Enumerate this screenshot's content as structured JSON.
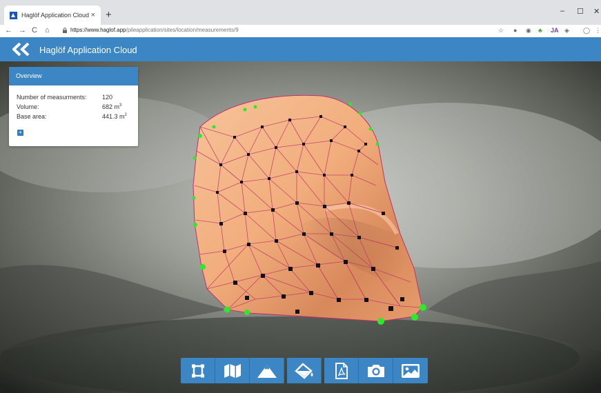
{
  "browser": {
    "tab_title": "Haglöf Application Cloud",
    "tab_close": "×",
    "new_tab": "+",
    "minimize": "–",
    "maximize": "☐",
    "close": "✕",
    "url_host": "https://www.haglof.app",
    "url_path": "/pileapplication/sites/location/measurements/9"
  },
  "app": {
    "title": "Haglöf Application Cloud"
  },
  "overview": {
    "heading": "Overview",
    "rows": [
      {
        "label": "Number of measurments:",
        "value": "120",
        "unit": ""
      },
      {
        "label": "Volume:",
        "value": "682 m",
        "unit": "3"
      },
      {
        "label": "Base area:",
        "value": "441.3 m",
        "unit": "2"
      }
    ],
    "expand_label": "+"
  },
  "toolbar": {
    "buttons": [
      {
        "name": "draw-boundary-button",
        "icon": "crop-frame-icon"
      },
      {
        "name": "map-button",
        "icon": "map-icon"
      },
      {
        "name": "terrain-button",
        "icon": "mountain-icon"
      },
      {
        "name": "fill-button",
        "icon": "paint-bucket-icon"
      },
      {
        "name": "pdf-report-button",
        "icon": "pdf-file-icon"
      },
      {
        "name": "camera-button",
        "icon": "camera-icon"
      },
      {
        "name": "image-button",
        "icon": "image-icon"
      }
    ]
  },
  "colors": {
    "brand": "#3d86c6",
    "pile_fill": "#f0aa78",
    "mesh_edge": "#c0306a",
    "boundary_point": "#2ee82e",
    "interior_point": "#111111"
  }
}
